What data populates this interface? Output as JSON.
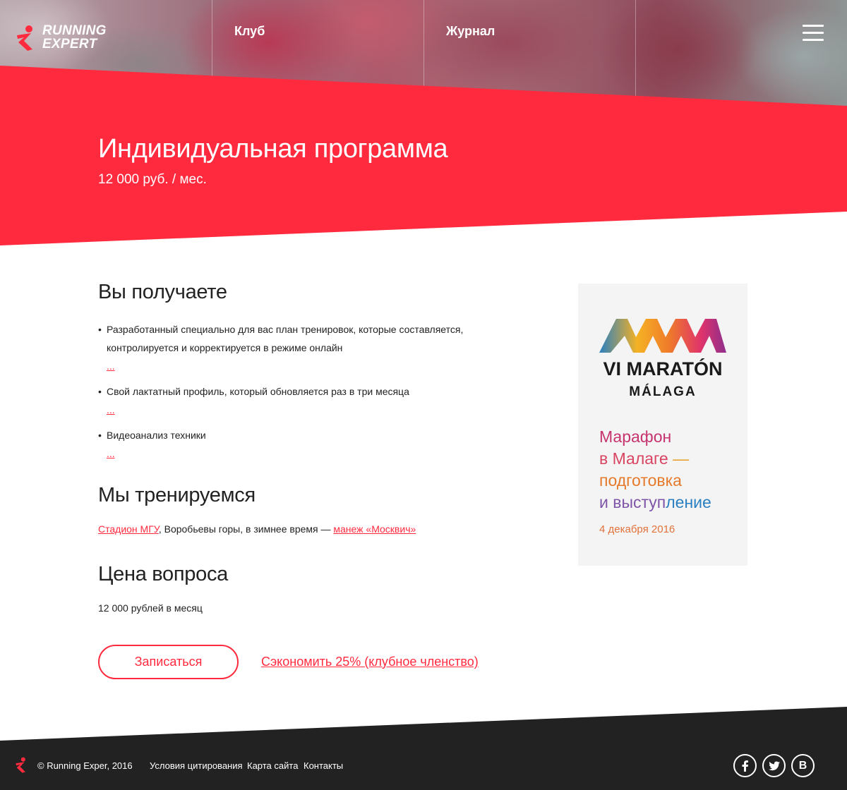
{
  "colors": {
    "brand_red": "#ff2a3e",
    "footer_bg": "#222222",
    "text": "#222222"
  },
  "header": {
    "logo": {
      "line1": "Running",
      "line2": "Expert"
    },
    "nav": [
      {
        "label": "Клуб"
      },
      {
        "label": "Журнал"
      }
    ],
    "menu_icon": "burger-menu-icon"
  },
  "hero": {
    "title": "Индивидуальная программа",
    "price": "12 000 руб. / мес."
  },
  "benefits": {
    "title": "Вы получаете",
    "items": [
      {
        "text": "Разработанный специально для вас план тренировок, которые составляется, контролируется и корректируется в режиме онлайн",
        "more": "..."
      },
      {
        "text": "Свой лактатный профиль, который обновляется раз в три месяца",
        "more": "..."
      },
      {
        "text": "Видеоанализ техники",
        "more": "..."
      }
    ]
  },
  "training": {
    "title": "Мы тренируемся",
    "link1": "Стадион МГУ",
    "middle": ", Воробьевы горы, в зимнее время — ",
    "link2": "манеж «Москвич»"
  },
  "price": {
    "title": "Цена вопроса",
    "text": "12 000 рублей в месяц"
  },
  "actions": {
    "signup_label": "Записаться",
    "save_label": "Сэкономить 25% (клубное членство)"
  },
  "ad": {
    "brand_line1": "VI MARATÓN",
    "brand_line2": "MÁLAGA",
    "headline": {
      "line1": "Марафон",
      "line2a": "в Малаге ",
      "line2b": "—",
      "line3": "подготовка",
      "line4a": "и выступ",
      "line4b": "ление"
    },
    "date": "4 декабря 2016"
  },
  "footer": {
    "copyright": "© Running Exper, 2016",
    "links": [
      {
        "label": "Условия цитирования"
      },
      {
        "label": "Карта сайта"
      },
      {
        "label": "Контакты"
      }
    ],
    "social": [
      {
        "icon": "facebook-icon"
      },
      {
        "icon": "twitter-icon"
      },
      {
        "icon": "vk-icon",
        "label": "В"
      }
    ]
  }
}
